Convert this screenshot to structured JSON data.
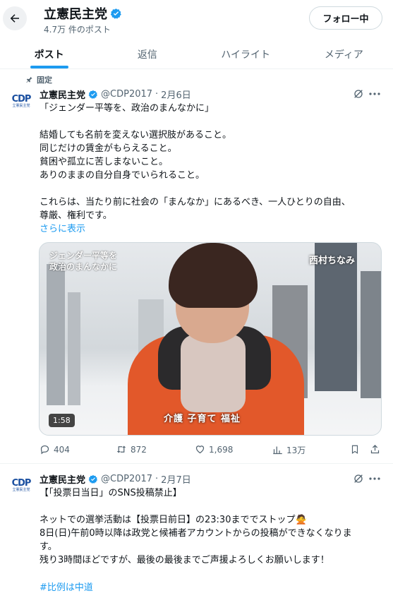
{
  "header": {
    "profile_name": "立憲民主党",
    "post_count": "4.7万 件のポスト",
    "follow_label": "フォロー中"
  },
  "tabs": [
    {
      "label": "ポスト",
      "active": true
    },
    {
      "label": "返信",
      "active": false
    },
    {
      "label": "ハイライト",
      "active": false
    },
    {
      "label": "メディア",
      "active": false
    }
  ],
  "colors": {
    "accent": "#1d9bf0",
    "secondary_text": "#536471",
    "verified": "#1d9bf0"
  },
  "posts": [
    {
      "pinned_label": "固定",
      "author": "立憲民主党",
      "handle": "@CDP2017",
      "separator": "·",
      "date": "2月6日",
      "avatar": {
        "brand": "CDP",
        "sub": "立憲民主党"
      },
      "text": "「ジェンダー平等を、政治のまんなかに」\n\n結婚しても名前を変えない選択肢があること。\n同じだけの賃金がもらえること。\n貧困や孤立に苦しまないこと。\nありのままの自分自身でいられること。\n\nこれらは、当たり前に社会の「まんなか」にあるべき、一人ひとりの自由、\n尊厳、権利です。",
      "show_more": "さらに表示",
      "video": {
        "overlay_title": "ジェンダー平等を\n政治のまんなかに",
        "overlay_name": "西村ちなみ",
        "caption": "介護 子育て 福祉",
        "duration": "1:58"
      },
      "stats": {
        "replies": "404",
        "reposts": "872",
        "likes": "1,698",
        "views": "13万"
      }
    },
    {
      "author": "立憲民主党",
      "handle": "@CDP2017",
      "separator": "·",
      "date": "2月7日",
      "avatar": {
        "brand": "CDP",
        "sub": "立憲民主党"
      },
      "text": "【「投票日当日」のSNS投稿禁止】\n\nネットでの選挙活動は【投票日前日】の23:30まででストップ🙅\n8日(日)午前0時以降は政党と候補者アカウントからの投稿ができなくなりま\nす。\n残り3時間ほどですが、最後の最後までご声援よろしくお願いします！",
      "hashtag": "#比例は中道"
    }
  ]
}
